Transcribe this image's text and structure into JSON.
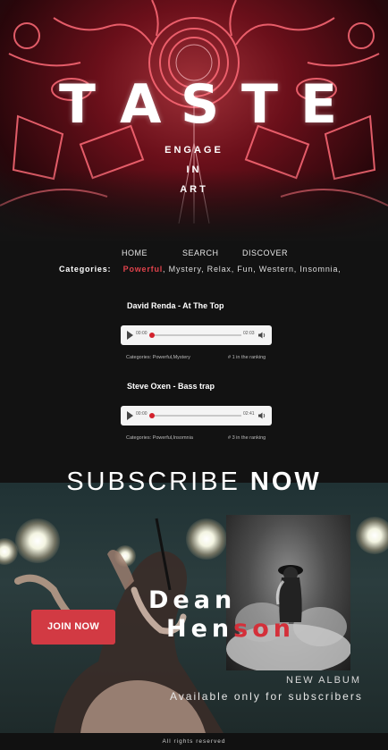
{
  "hero": {
    "title_letters": [
      "T",
      "A",
      "S",
      "T",
      "E"
    ],
    "tagline": [
      "ENGAGE",
      "IN",
      "ART"
    ]
  },
  "nav": {
    "items": [
      "HOME",
      "SEARCH",
      "DISCOVER"
    ]
  },
  "categories": {
    "label": "Categories:",
    "active": "Powerful",
    "rest": ", Mystery, Relax, Fun, Western, Insomnia,"
  },
  "tracks": [
    {
      "title": "David Renda - At The Top",
      "current_time": "00:00",
      "total_time": "02:03",
      "categories": "Categories: Powerful,Mystery",
      "ranking": "# 1 in the ranking"
    },
    {
      "title": "Steve Oxen - Bass trap",
      "current_time": "00:00",
      "total_time": "02:41",
      "categories": "Categories: Powerful,Insomnia",
      "ranking": "# 3 in the ranking"
    }
  ],
  "subscribe": {
    "light": "SUBSCRIBE",
    "bold": "NOW"
  },
  "promo": {
    "artist_first": "Dean",
    "artist_last_white": "Hen",
    "artist_last_red": "son",
    "join_label": "JOIN NOW",
    "new_album": "NEW ALBUM",
    "available": "Available only for subscribers"
  },
  "footer": {
    "text": "All rights reserved"
  },
  "colors": {
    "accent": "#d23a43",
    "background": "#121212"
  },
  "icons": {
    "play": "play-icon",
    "volume": "volume-icon"
  }
}
